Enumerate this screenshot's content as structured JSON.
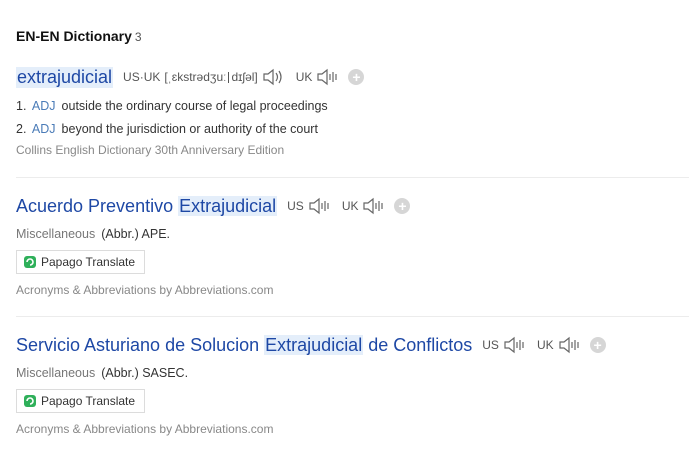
{
  "section": {
    "title": "EN-EN Dictionary",
    "count": "3"
  },
  "entry1": {
    "word": "extrajudicial",
    "pron_label": "US·UK",
    "ipa": "[ˌɛkstrədʒuː",
    "ipa_tail": "dɪʃəl]",
    "uk_label": "UK",
    "defs": [
      {
        "num": "1.",
        "pos": "ADJ",
        "text": "outside the ordinary course of legal proceedings"
      },
      {
        "num": "2.",
        "pos": "ADJ",
        "text": "beyond the jurisdiction or authority of the court"
      }
    ],
    "source": "Collins English Dictionary 30th Anniversary Edition"
  },
  "entry2": {
    "word_pre": "Acuerdo Preventivo ",
    "word_hl": "Extrajudicial",
    "word_post": "",
    "us_label": "US",
    "uk_label": "UK",
    "category": "Miscellaneous",
    "abbr": "(Abbr.) APE.",
    "papago": "Papago Translate",
    "source": "Acronyms & Abbreviations by Abbreviations.com"
  },
  "entry3": {
    "word_pre": "Servicio Asturiano de Solucion ",
    "word_hl": "Extrajudicial",
    "word_post": " de Conflictos",
    "us_label": "US",
    "uk_label": "UK",
    "category": "Miscellaneous",
    "abbr": "(Abbr.) SASEC.",
    "papago": "Papago Translate",
    "source": "Acronyms & Abbreviations by Abbreviations.com"
  },
  "icons": {
    "speaker": "speaker-icon",
    "add": "add-circle-icon",
    "papago": "papago-logo-icon"
  },
  "colors": {
    "link": "#1e48a5",
    "highlight": "#e4eefa",
    "pos": "#4a7bb7",
    "papago_green": "#2fb05a"
  }
}
